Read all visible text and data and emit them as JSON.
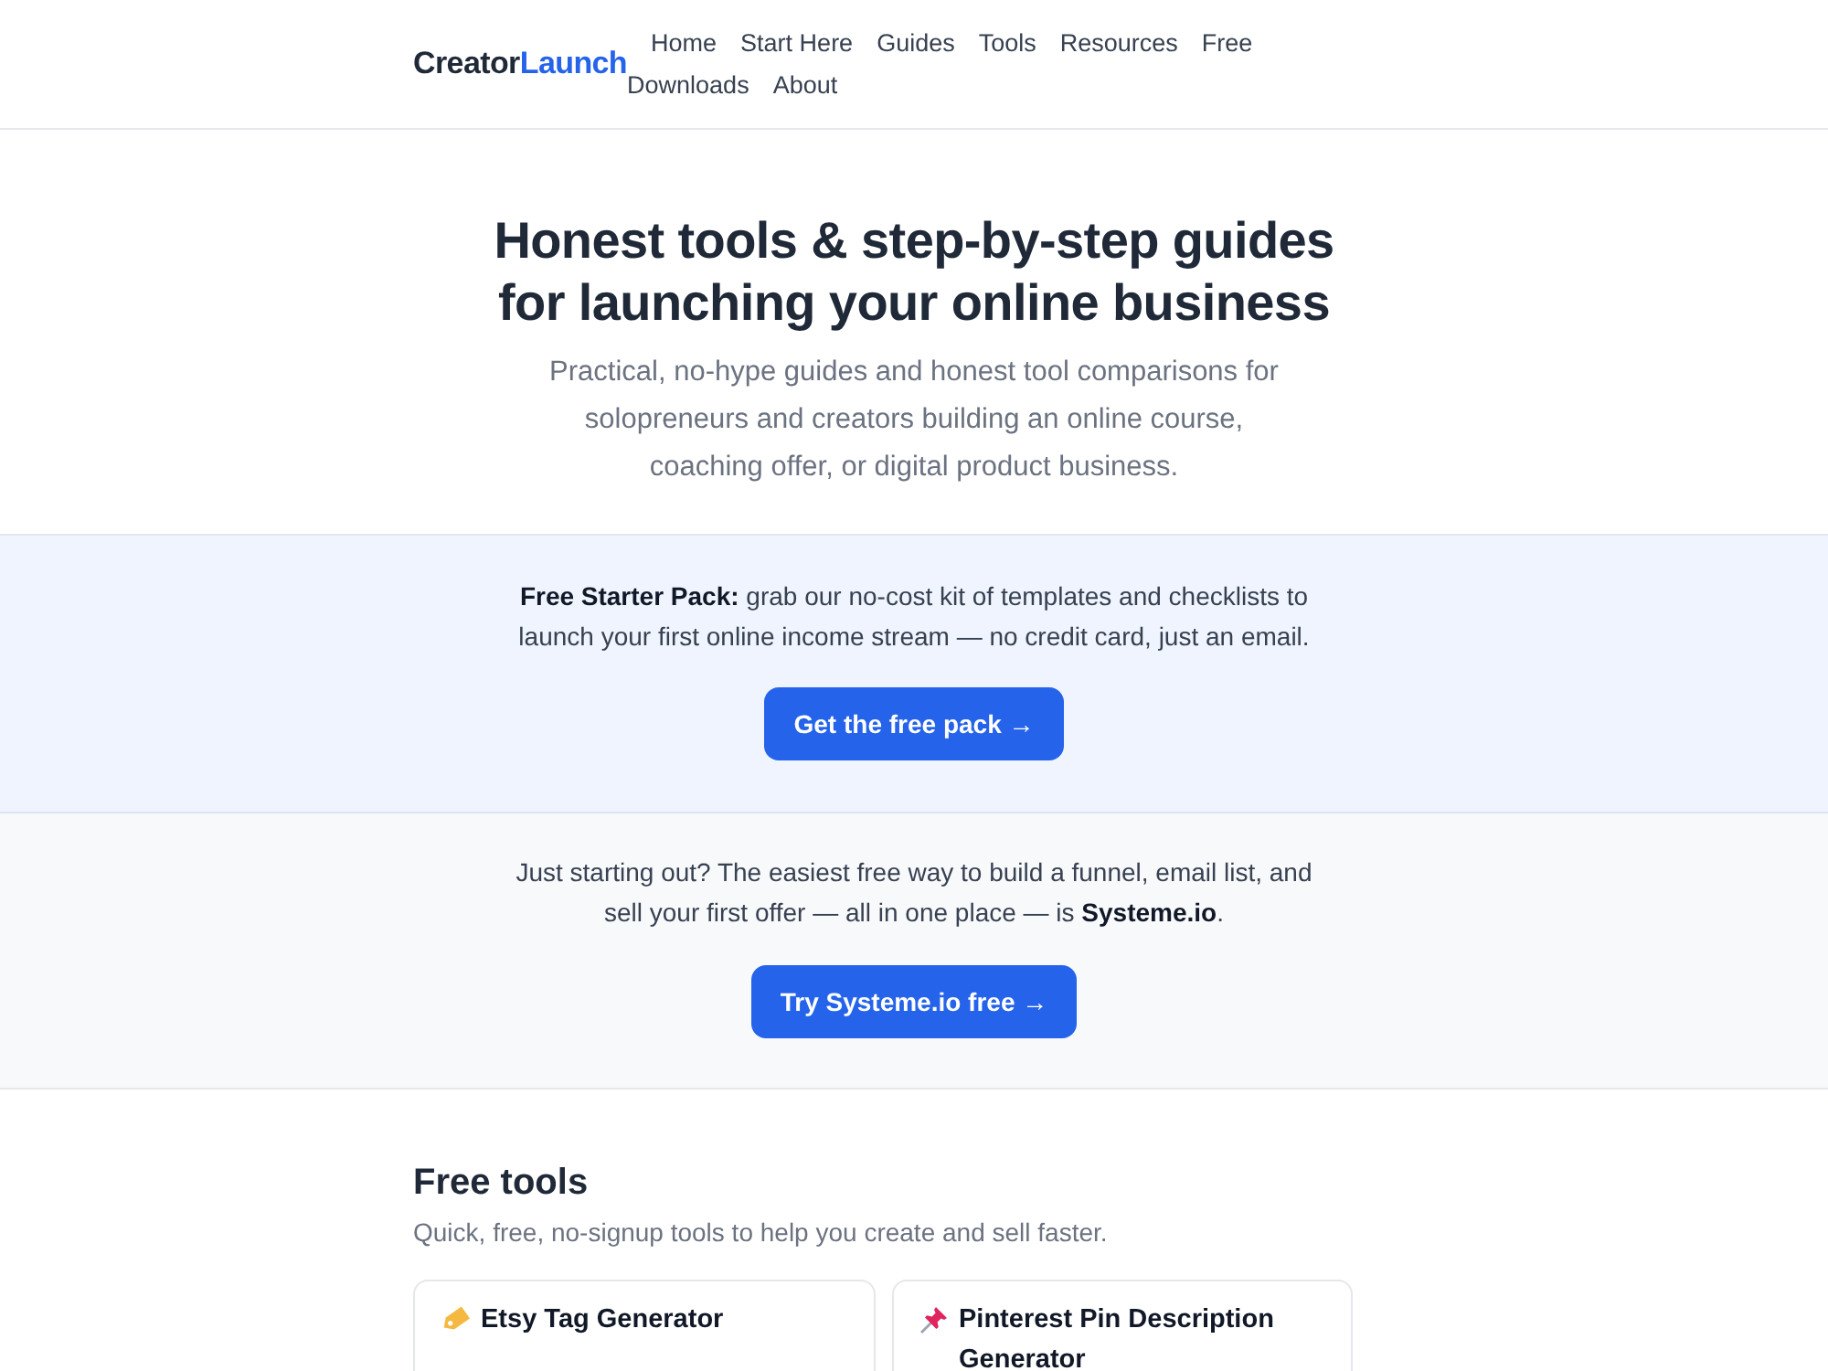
{
  "header": {
    "logo": {
      "part_1": "Creator",
      "part_2": "Launch"
    },
    "nav_rows": [
      [
        "Home",
        "Start Here",
        "Guides",
        "Tools",
        "Resources",
        "Free"
      ],
      [
        "Downloads",
        "About"
      ]
    ]
  },
  "hero": {
    "title": "Honest tools & step-by-step guides for launching your online business",
    "subtitle": "Practical, no-hype guides and honest tool comparisons for solopreneurs and creators building an online course, coaching offer, or digital product business."
  },
  "starter_pack": {
    "text": "**Free Starter Pack:** grab our no-cost kit of templates and checklists to launch your first online income stream — no credit card, just an email.",
    "button": "Get the free pack →"
  },
  "systeme_promo": {
    "text": "Just starting out? The easiest free way to build a funnel, email list, and sell your first offer — all in one place — is **Systeme.io**.",
    "button": "Try Systeme.io free →"
  },
  "free_tools": {
    "title": "Free tools",
    "subtitle": "Quick, free, no-signup tools to help you create and sell faster.",
    "cards": [
      {
        "kind": "tag",
        "title": "Etsy Tag Generator"
      },
      {
        "kind": "pin",
        "title": "Pinterest Pin Description Generator"
      }
    ]
  }
}
